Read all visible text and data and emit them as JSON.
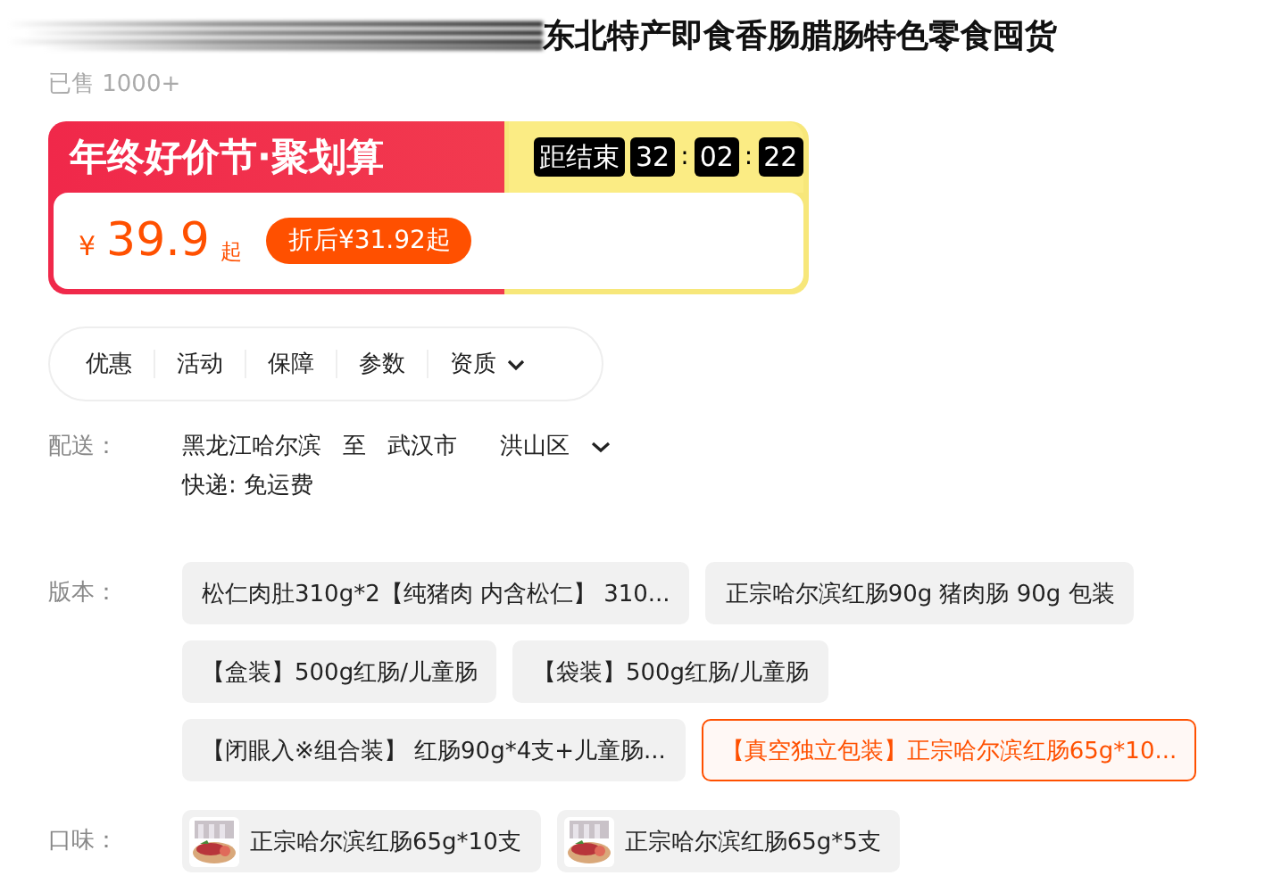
{
  "title": "东北特产即食香肠腊肠特色零食囤货",
  "sold": "已售 1000+",
  "promo": {
    "banner": "年终好价节·聚划算",
    "countdown_label": "距结束",
    "countdown": [
      {
        "value": "32"
      },
      {
        "sep": ":",
        "value": "02"
      },
      {
        "sep": ":",
        "value": "22"
      }
    ],
    "currency": "¥",
    "price": "39.9",
    "suffix": "起",
    "discount": "折后¥31.92起"
  },
  "tabs": [
    {
      "label": "优惠",
      "dropdown": false
    },
    {
      "label": "活动",
      "dropdown": false
    },
    {
      "label": "保障",
      "dropdown": false
    },
    {
      "label": "参数",
      "dropdown": false
    },
    {
      "label": "资质",
      "dropdown": true
    }
  ],
  "delivery": {
    "label": "配送：",
    "from": "黑龙江哈尔滨",
    "to": "至",
    "city": "武汉市",
    "district": "洪山区",
    "shipping": "快递: 免运费"
  },
  "versions": {
    "label": "版本：",
    "options": [
      {
        "label": "松仁肉肚310g*2【纯猪肉 内含松仁】 310...",
        "selected": false
      },
      {
        "label": "正宗哈尔滨红肠90g 猪肉肠 90g 包装",
        "selected": false
      },
      {
        "label": "【盒装】500g红肠/儿童肠",
        "selected": false
      },
      {
        "label": "【袋装】500g红肠/儿童肠",
        "selected": false
      },
      {
        "label": "【闭眼入※组合装】 红肠90g*4支+儿童肠...",
        "selected": false
      },
      {
        "label": "【真空独立包装】正宗哈尔滨红肠65g*10...",
        "selected": true
      }
    ]
  },
  "flavors": {
    "label": "口味：",
    "options": [
      {
        "label": "正宗哈尔滨红肠65g*10支",
        "selected": false
      },
      {
        "label": "正宗哈尔滨红肠65g*5支",
        "selected": false
      }
    ]
  }
}
